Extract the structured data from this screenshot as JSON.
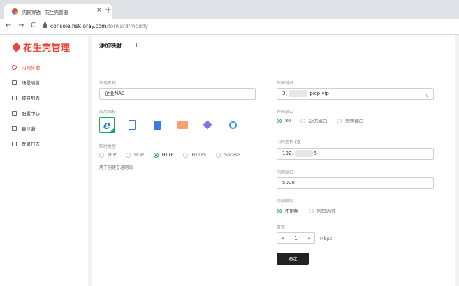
{
  "browser": {
    "tab_title": "内网穿透 - 花生壳管理",
    "tab_close": "×",
    "new_tab": "+",
    "back": "←",
    "forward": "→",
    "reload": "C",
    "url_host": "console.hsk.oray.com",
    "url_path": "/forward/modify"
  },
  "sidebar": {
    "logo_text": "花生壳管理",
    "items": [
      {
        "label": "内网穿透",
        "icon": "gear-icon",
        "active": true
      },
      {
        "label": "场景映射",
        "icon": "scene-icon"
      },
      {
        "label": "域名列表",
        "icon": "list-icon"
      },
      {
        "label": "配置中心",
        "icon": "grid-icon"
      },
      {
        "label": "自诊断",
        "icon": "diagnose-icon"
      },
      {
        "label": "登录日志",
        "icon": "log-icon"
      }
    ]
  },
  "page": {
    "title": "添加映射"
  },
  "left_form": {
    "app_name_label": "应用名称",
    "app_name_value": "企业NAS",
    "app_icon_label": "应用图标",
    "app_icons": [
      "ie-icon",
      "tablet-icon",
      "document-icon",
      "code-icon",
      "gem-icon",
      "location-icon"
    ],
    "mapping_type_label": "映射类型",
    "mapping_types": [
      "TCP",
      "UDP",
      "HTTP",
      "HTTPS",
      "Socks5"
    ],
    "mapping_type_selected": "HTTP",
    "hint": "用于创建普通网站"
  },
  "right_form": {
    "domain_label": "外网域名",
    "domain_prefix": "3(",
    "domain_suffix": ".picp.vip",
    "domain_chevron": "∨",
    "port_label": "外网端口",
    "port_options": [
      "80",
      "动态端口",
      "固定端口"
    ],
    "port_selected": "80",
    "host_label": "内网主机",
    "host_help": "?",
    "host_prefix": "192.",
    "host_suffix": "5",
    "inner_port_label": "内网端口",
    "inner_port_value": "5000",
    "access_label": "访问限制",
    "access_options": [
      "不限制",
      "密码访问"
    ],
    "access_selected": "不限制",
    "bandwidth_label": "带宽",
    "bandwidth_value": "1",
    "bandwidth_unit": "Mbps",
    "submit_label": "确定"
  },
  "colors": {
    "brand": "#e8453c",
    "accent_green": "#1ea85a",
    "button_dark": "#222222"
  }
}
